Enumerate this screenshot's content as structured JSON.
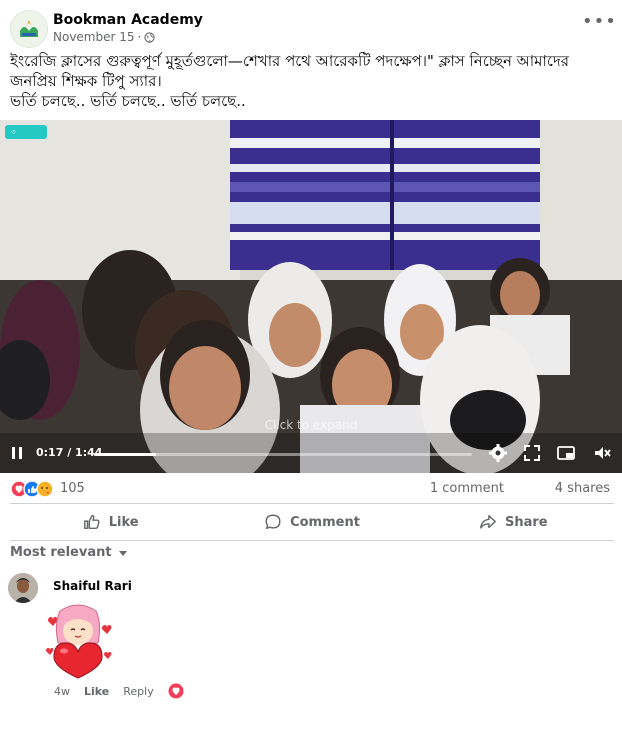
{
  "page": {
    "name": "Bookman Academy",
    "date": "November 15",
    "separator": "·"
  },
  "caption": {
    "line1": "ইংরেজি ক্লাসের গুরুত্বপূর্ণ মুহূর্তগুলো—শেখার পথে আরেকটি পদক্ষেপ।\" ক্লাস নিচ্ছেন আমাদের জনপ্রিয় শিক্ষক টিপু স্যার।",
    "line2": "ভর্তি চলছে.. ভর্তি চলছে.. ভর্তি চলছে.."
  },
  "video": {
    "badge": "৩",
    "hint": "Click to expand",
    "time": "0:17 / 1:44",
    "progress": 0.163
  },
  "stats": {
    "reactions": "105",
    "comments": "1 comment",
    "shares": "4 shares"
  },
  "actions": {
    "like": "Like",
    "comment": "Comment",
    "share": "Share"
  },
  "filter": {
    "label": "Most relevant"
  },
  "comment": {
    "author": "Shaiful Rari",
    "age": "4w",
    "like": "Like",
    "reply": "Reply"
  },
  "colors": {
    "link_blue": "#1877f2",
    "muted": "#65676b",
    "love_red": "#f33e58",
    "badge_teal": "#25c9c4"
  }
}
